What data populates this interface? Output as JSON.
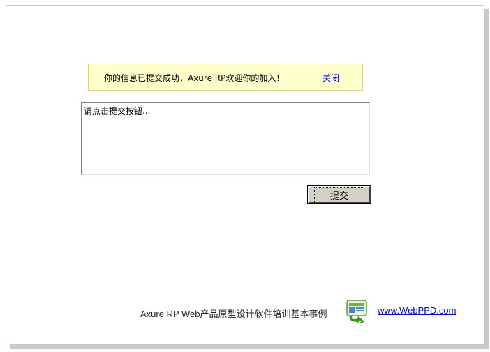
{
  "notice": {
    "message": "你的信息已提交成功，Axure RP欢迎你的加入！",
    "close_label": "关闭"
  },
  "form": {
    "textarea_value": "请点击提交按钮...",
    "submit_label": "提交"
  },
  "footer": {
    "text": "Axure  RP    Web产品原型设计软件培训基本事例",
    "link_text": "www.WebPPD.com",
    "icon": "webppd-logo-icon"
  },
  "colors": {
    "notice_bg": "#ffffcc",
    "link": "#0000cc",
    "button_face": "#d4d0c8"
  }
}
